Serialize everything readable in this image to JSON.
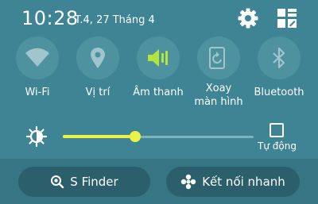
{
  "status": {
    "time": "10:28",
    "date": "T.4, 27 Tháng 4"
  },
  "header_icons": [
    "gear-icon",
    "grid-edit-icon"
  ],
  "toggles": [
    {
      "icon": "wifi-icon",
      "label": "Wi-Fi",
      "active": false
    },
    {
      "icon": "location-pin-icon",
      "label": "Vị trí",
      "active": false
    },
    {
      "icon": "speaker-icon",
      "label": "Âm thanh",
      "active": true
    },
    {
      "icon": "rotate-icon",
      "label_line1": "Xoay",
      "label_line2": "màn hình",
      "active": false
    },
    {
      "icon": "bluetooth-icon",
      "label": "Bluetooth",
      "active": false
    }
  ],
  "brightness": {
    "level": 0.38,
    "auto_label": "Tự động",
    "auto_checked": false
  },
  "buttons": {
    "s_finder": "S Finder",
    "quick_connect": "Kết nối nhanh"
  },
  "colors": {
    "accent_yellow": "#ecf245",
    "active_green": "#b3e63a"
  }
}
